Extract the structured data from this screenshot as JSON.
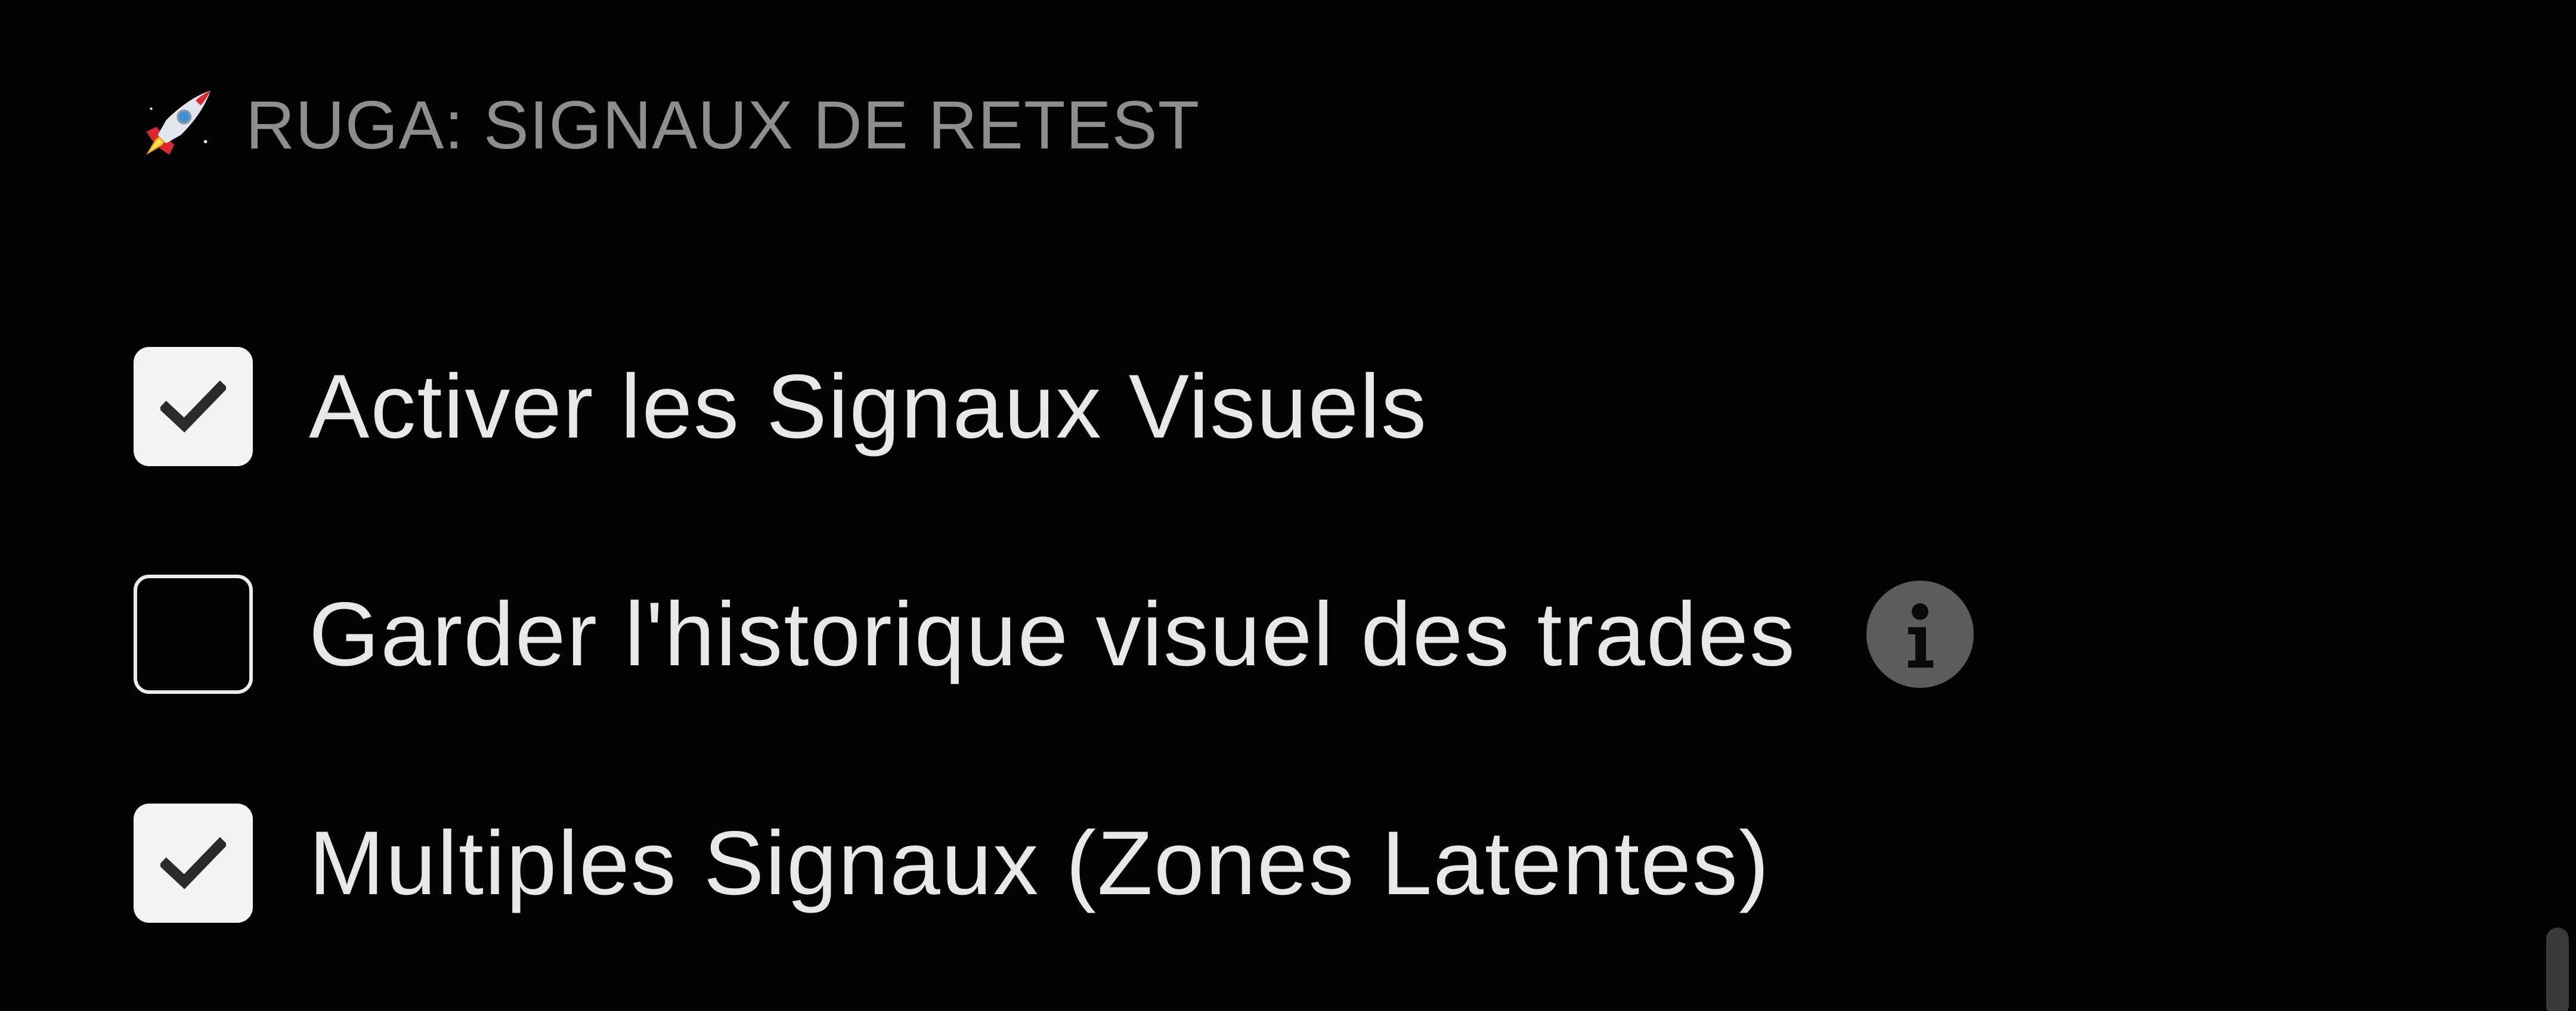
{
  "section": {
    "icon": "rocket-icon",
    "title": "RUGA: SIGNAUX DE RETEST"
  },
  "options": [
    {
      "label": "Activer les Signaux Visuels",
      "checked": true
    },
    {
      "label": "Garder l'historique visuel des trades",
      "checked": false,
      "info_icon": "info-icon"
    },
    {
      "label": "Multiples Signaux (Zones Latentes)",
      "checked": true
    }
  ],
  "colors": {
    "background": "#020202",
    "title": "#8e8e8e",
    "label": "#e8e8e8",
    "checkbox_fill": "#f3f3f3",
    "checkmark": "#2a2a2a",
    "info_bg": "#5c5c5c"
  }
}
